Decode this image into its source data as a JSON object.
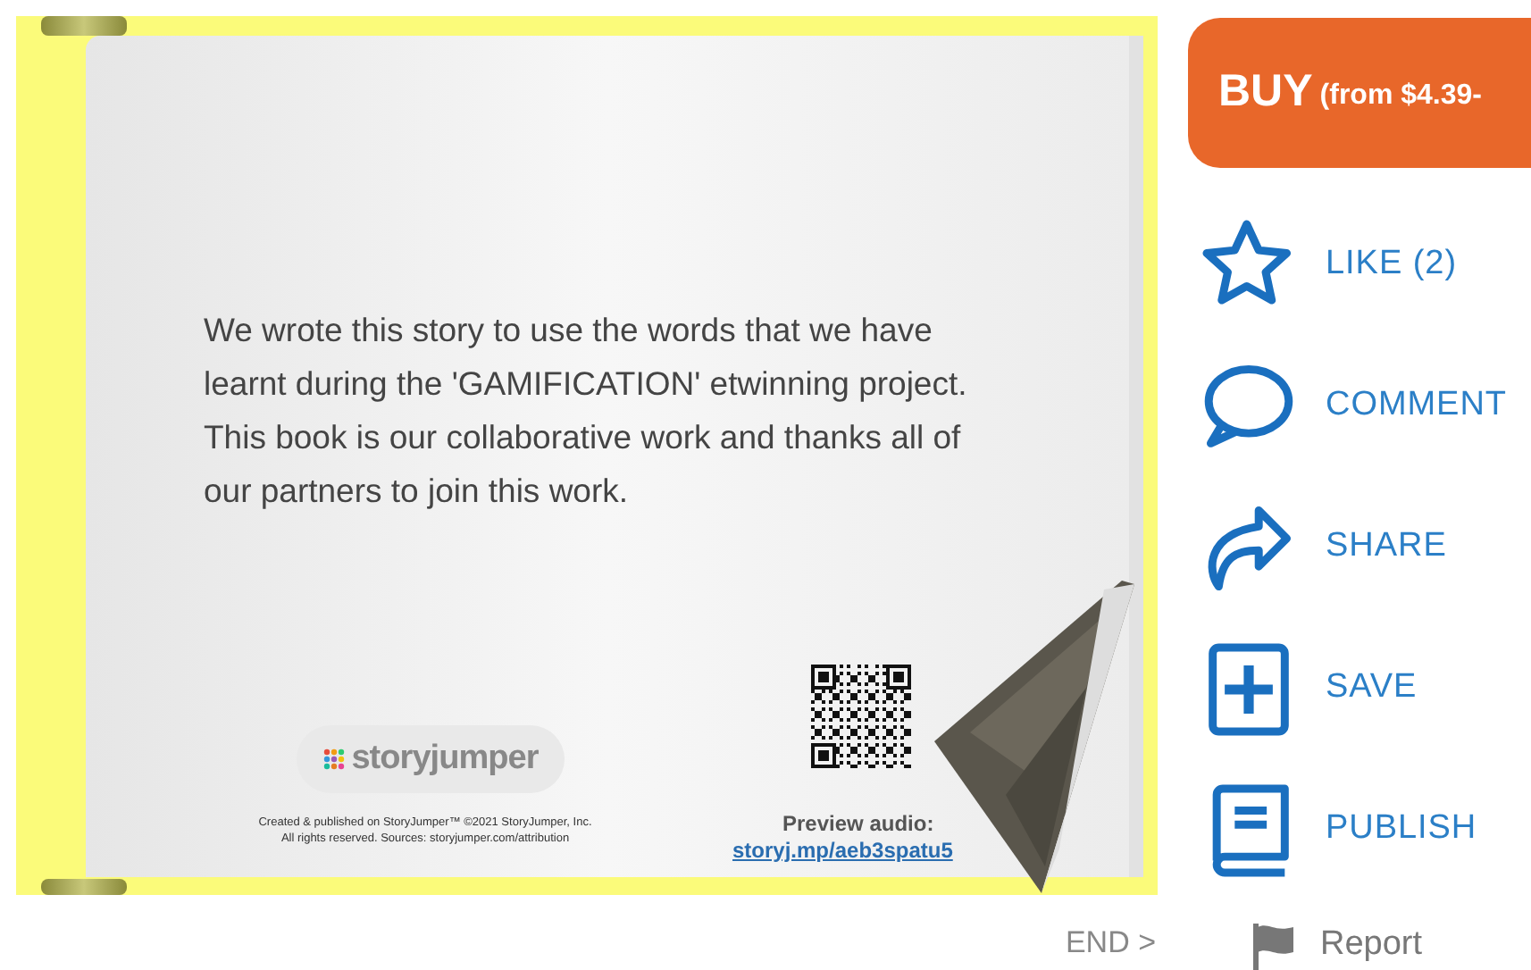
{
  "book": {
    "paragraphs": [
      "We wrote this story to use the words that we have learnt during the 'GAMIFICATION' etwinning project.",
      "This book is our collaborative work and thanks all of our partners to join this work."
    ],
    "logo": "**story**jumper",
    "credits": [
      "Created & published on StoryJumper™ ©2021 StoryJumper, Inc.",
      "All rights reserved. Sources: storyjumper.com/attribution"
    ],
    "preview_label": "Preview audio:",
    "preview_link": "storyj.mp/aeb3spatu5"
  },
  "buy_button": {
    "label": "BUY",
    "price": "(from $4.39-"
  },
  "actions": [
    {
      "kind": "like",
      "label": "LIKE (2)"
    },
    {
      "kind": "comment",
      "label": "COMMENT"
    },
    {
      "kind": "share",
      "label": "SHARE"
    },
    {
      "kind": "save",
      "label": "SAVE"
    },
    {
      "kind": "publish",
      "label": "PUBLISH"
    }
  ],
  "end_link": "END >",
  "report": "Report"
}
